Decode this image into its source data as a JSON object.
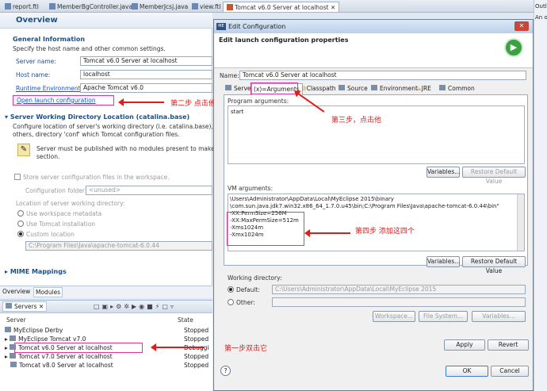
{
  "editor_tabs": [
    "report.ftl",
    "MemberBgController.java",
    "MemberJcsj.java",
    "view.ftl",
    "Tomcat v6.0 Server at localhost"
  ],
  "right_panel": {
    "outline": "Outline",
    "note": "An outline"
  },
  "overview": {
    "title": "Overview",
    "general_info": {
      "heading": "General Information",
      "desc": "Specify the host name and other common settings.",
      "server_name_label": "Server name:",
      "server_name": "Tomcat v6.0 Server at localhost",
      "host_name_label": "Host name:",
      "host_name": "localhost",
      "runtime_label": "Runtime Environment:",
      "runtime": "Apache Tomcat v6.0",
      "open_launch": "Open launch configuration"
    },
    "location": {
      "heading": "Server Working Directory Location (catalina.base)",
      "desc1": "Configure location of server's working directory (i.e. catalina.base), which c",
      "desc2": "others, directory 'conf' which Tomcat configuration files.",
      "warn1": "Server must be published with no modules present to make any c",
      "warn2": "section.",
      "store_checkbox": "Store server configuration files in the workspace.",
      "config_folder_label": "Configuration folder:",
      "config_folder": "<unused>",
      "location_label": "Location of server working directory:",
      "opt1": "Use workspace metadata",
      "opt2": "Use Tomcat installation",
      "opt3": "Custom location",
      "custom_path": "C:\\Program Files\\Java\\apache-tomcat-6.0.44"
    },
    "mime": "MIME Mappings",
    "bottom_tabs": [
      "Overview",
      "Modules"
    ]
  },
  "servers_view": {
    "tab": "Servers",
    "col_server": "Server",
    "col_state": "State",
    "rows": [
      {
        "name": "MyEclipse Derby",
        "state": "Stopped"
      },
      {
        "name": "MyEclipse Tomcat v7.0",
        "state": "Stopped"
      },
      {
        "name": "Tomcat v6.0 Server at localhost",
        "state": "Debuggi"
      },
      {
        "name": "Tomcat v7.0 Server at localhost",
        "state": "Stopped"
      },
      {
        "name": "Tomcat v8.0 Server at localhost",
        "state": "Stopped"
      }
    ]
  },
  "dialog": {
    "title": "Edit Configuration",
    "banner": "Edit launch configuration properties",
    "name_label": "Name:",
    "name_value": "Tomcat v6.0 Server at localhost",
    "tabs": [
      "Server",
      "Arguments",
      "Classpath",
      "Source",
      "Environment",
      "JRE",
      "Common"
    ],
    "program_args_label": "Program arguments:",
    "program_args": "start",
    "variables": "Variables...",
    "restore": "Restore Default Value",
    "vm_args_label": "VM arguments:",
    "vm_lines": [
      "\\Users\\Administrator\\AppData\\Local\\MyEclipse 2015\\binary",
      "\\com.sun.java.jdk7.win32.x86_64_1.7.0.u45\\bin;C:\\Program Files\\Java\\apache-tomcat-6.0.44\\bin\"",
      "-XX:PermSize=256M",
      "-XX:MaxPermSize=512m",
      "-Xms1024m",
      "-Xmx1024m"
    ],
    "working_dir_label": "Working directory:",
    "default_label": "Default:",
    "default_value": "C:\\Users\\Administrator\\AppData\\Local\\MyEclipse 2015",
    "other_label": "Other:",
    "workspace_btn": "Workspace...",
    "filesystem_btn": "File System...",
    "variables2_btn": "Variables...",
    "apply": "Apply",
    "revert": "Revert",
    "ok": "OK",
    "cancel": "Cancel"
  },
  "annotations": {
    "step1": "第一步双击它",
    "step2": "第二步 点击他",
    "step3": "第三步，点击他",
    "step4": "第四步 添加这四个"
  }
}
